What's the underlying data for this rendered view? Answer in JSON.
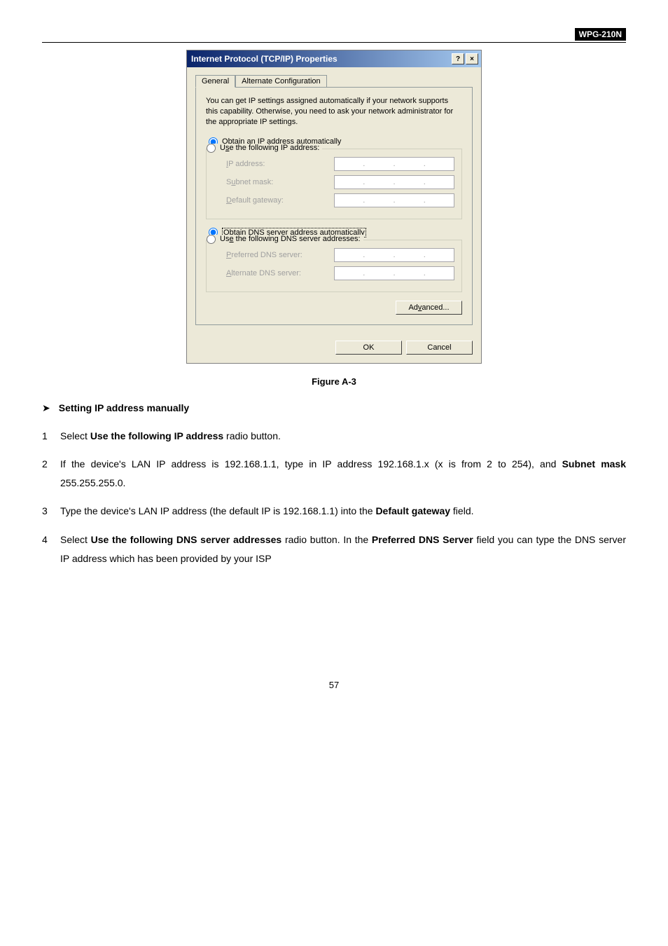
{
  "header": {
    "device": "WPG-210N"
  },
  "dialog": {
    "title": "Internet Protocol (TCP/IP) Properties",
    "help_btn": "?",
    "close_btn": "×",
    "tabs": {
      "general": "General",
      "alt": "Alternate Configuration"
    },
    "desc": "You can get IP settings assigned automatically if your network supports this capability. Otherwise, you need to ask your network administrator for the appropriate IP settings.",
    "ip": {
      "auto": "Obtain an IP address automatically",
      "manual": "Use the following IP address:",
      "ip_label": "IP address:",
      "subnet_label": "Subnet mask:",
      "gateway_label": "Default gateway:"
    },
    "dns": {
      "auto": "Obtain DNS server address automatically",
      "manual": "Use the following DNS server addresses:",
      "preferred_label": "Preferred DNS server:",
      "alternate_label": "Alternate DNS server:"
    },
    "advanced_btn": "Advanced...",
    "ok_btn": "OK",
    "cancel_btn": "Cancel"
  },
  "figure_caption": "Figure A-3",
  "section_heading": "Setting IP address manually",
  "steps": {
    "s1_a": "Select ",
    "s1_b": "Use the following IP address",
    "s1_c": " radio button.",
    "s2_a": "If the device's LAN IP address is 192.168.1.1, type in IP address 192.168.1.x (x is from 2 to 254), and ",
    "s2_b": "Subnet mask",
    "s2_c": " 255.255.255.0.",
    "s3_a": "Type the device's LAN IP address (the default IP is 192.168.1.1) into the ",
    "s3_b": "Default gateway",
    "s3_c": " field.",
    "s4_a": "Select ",
    "s4_b": "Use the following DNS server addresses",
    "s4_c": " radio button. In the ",
    "s4_d": "Preferred DNS Server",
    "s4_e": " field you can type the DNS server IP address which has been provided by your ISP"
  },
  "page_number": "57"
}
